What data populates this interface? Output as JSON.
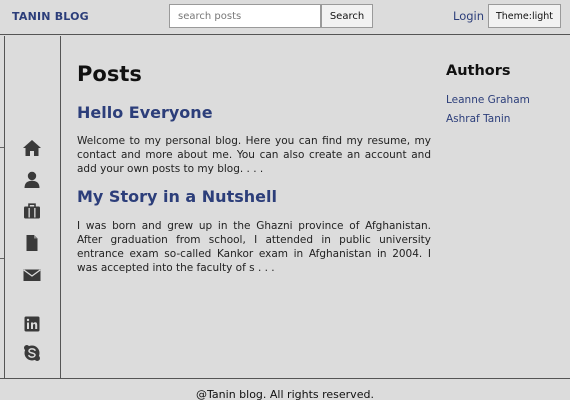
{
  "header": {
    "brand": "TANIN BLOG",
    "search_placeholder": "search posts",
    "search_button": "Search",
    "login": "Login",
    "theme_button": "Theme:light"
  },
  "sidebar": {
    "icons": [
      "home-icon",
      "user-icon",
      "briefcase-icon",
      "document-icon",
      "mail-icon",
      "linkedin-icon",
      "skype-icon"
    ]
  },
  "main": {
    "title": "Posts",
    "posts": [
      {
        "title": "Hello Everyone",
        "excerpt": "Welcome to my personal blog. Here you can find my resume, my contact and more about me. You can also create an account and add your own posts to my blog.   . . ."
      },
      {
        "title": "My Story in a Nutshell",
        "excerpt": "I was born and grew up in the Ghazni province of Afghanistan. After graduation from school, I attended in public university entrance exam so-called Kankor exam in Afghanistan in 2004. I was accepted into the faculty of s . . ."
      }
    ]
  },
  "authors": {
    "title": "Authors",
    "list": [
      "Leanne Graham",
      "Ashraf Tanin"
    ]
  },
  "footer": {
    "text": "@Tanin blog. All rights reserved."
  },
  "colors": {
    "background": "#dcdcdc",
    "accent": "#2c3e7a",
    "border": "#555555"
  }
}
